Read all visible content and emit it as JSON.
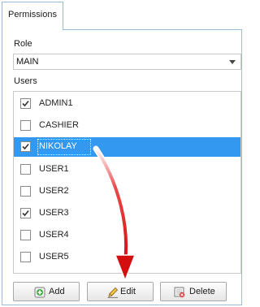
{
  "tabs": [
    {
      "label": "Permissions",
      "active": true
    }
  ],
  "role": {
    "label": "Role",
    "selected": "MAIN"
  },
  "users": {
    "label": "Users",
    "items": [
      {
        "name": "ADMIN1",
        "checked": true,
        "selected": false
      },
      {
        "name": "CASHIER",
        "checked": false,
        "selected": false
      },
      {
        "name": "NIKOLAY",
        "checked": true,
        "selected": true
      },
      {
        "name": "USER1",
        "checked": false,
        "selected": false
      },
      {
        "name": "USER2",
        "checked": false,
        "selected": false
      },
      {
        "name": "USER3",
        "checked": true,
        "selected": false
      },
      {
        "name": "USER4",
        "checked": false,
        "selected": false
      },
      {
        "name": "USER5",
        "checked": false,
        "selected": false
      }
    ]
  },
  "buttons": {
    "add": {
      "label": "Add",
      "icon": "add-icon"
    },
    "edit": {
      "label": "Edit",
      "icon": "pencil-icon"
    },
    "delete": {
      "label": "Delete",
      "icon": "delete-icon"
    }
  },
  "colors": {
    "selection": "#3399f0",
    "annotation_arrow": "#e01010",
    "border": "#9dbcd9"
  }
}
